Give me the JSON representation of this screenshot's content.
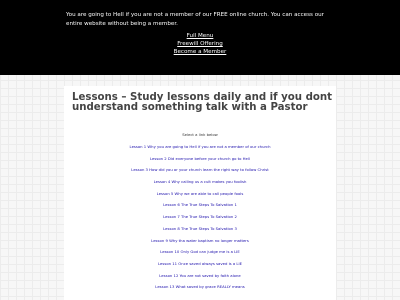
{
  "header": {
    "intro": "You are going to Hell if you are not a member of our FREE online church. You can access our entire website without being a member.",
    "menu": [
      "Full Menu",
      "Freewill Offering",
      "Become a Member"
    ]
  },
  "main": {
    "title": "Lessons – Study lessons daily and if you dont understand something talk with a Pastor",
    "subtitle": "Select a link below",
    "lessons": [
      "Lesson 1 Why you are going to Hell if you are not a member of our church",
      "Lesson 2 Did everyone before your church go to Hell",
      "Lesson 3 How did you or your church learn the right way to follow Christ",
      "Lesson 4 Why calling us a cult makes you foolish",
      "Lesson 5 Why we are able to call people fools",
      "Lesson 6 The True Steps To Salvation 1",
      "Lesson 7 The True Steps To Salvation 2",
      "Lesson 8 The True Steps To Salvation 3",
      "Lesson 9 Why tha water baptism no longer matters",
      "Lesson 10 Only God can judge me is a LIE",
      "Lesson 11 Once saved always saved is a LIE",
      "Lesson 12 You are not saved by faith alone",
      "Lesson 13 What saved by grace REALLY means"
    ]
  }
}
